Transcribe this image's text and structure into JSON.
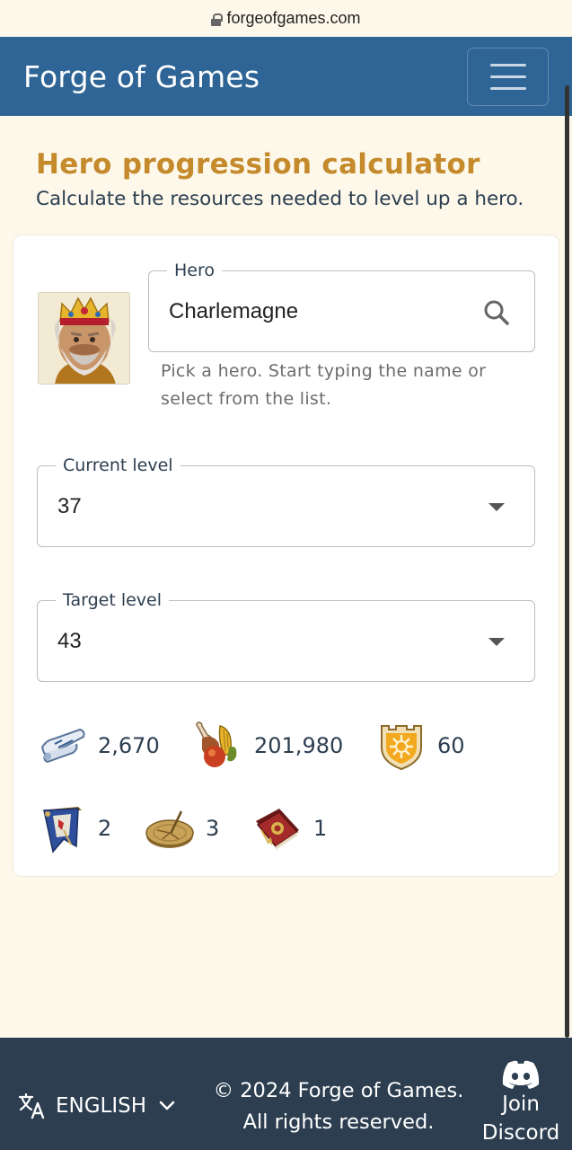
{
  "browser": {
    "url": "forgeofgames.com",
    "lock_icon": "lock-icon"
  },
  "navbar": {
    "brand": "Forge of Games",
    "menu_icon": "hamburger-icon"
  },
  "page": {
    "title": "Hero progression calculator",
    "subtitle": "Calculate the resources needed to level up a hero."
  },
  "form": {
    "hero": {
      "label": "Hero",
      "value": "Charlemagne",
      "helper": "Pick a hero. Start typing the name or select from the list.",
      "portrait_icon": "hero-portrait-charlemagne"
    },
    "current_level": {
      "label": "Current level",
      "value": "37"
    },
    "target_level": {
      "label": "Target level",
      "value": "43"
    }
  },
  "resources": [
    {
      "icon": "scroll-icon",
      "amount": "2,670"
    },
    {
      "icon": "food-icon",
      "amount": "201,980"
    },
    {
      "icon": "shield-emblem-icon",
      "amount": "60"
    },
    {
      "icon": "banner-icon",
      "amount": "2"
    },
    {
      "icon": "sundial-icon",
      "amount": "3"
    },
    {
      "icon": "book-icon",
      "amount": "1"
    }
  ],
  "footer": {
    "language": "ENGLISH",
    "copyright": "© 2024 Forge of Games. All rights reserved.",
    "discord": "Join Discord"
  },
  "colors": {
    "navbar": "#2e6596",
    "page_bg": "#fdf8ea",
    "title": "#c48a2b",
    "footer": "#2c3e50"
  }
}
